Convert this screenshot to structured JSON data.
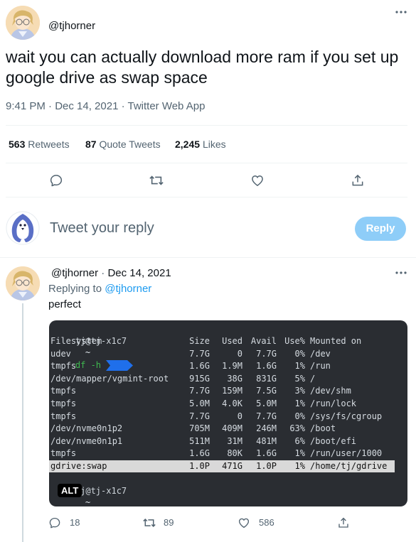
{
  "tweet": {
    "handle": "@tjhorner",
    "text": "wait you can actually download more ram if you set up google drive as swap space",
    "meta": "9:41 PM · Dec 14, 2021 · Twitter Web App",
    "stats": {
      "retweets_count": "563",
      "retweets_label": "Retweets",
      "quotes_count": "87",
      "quotes_label": "Quote Tweets",
      "likes_count": "2,245",
      "likes_label": "Likes"
    }
  },
  "composer": {
    "placeholder": "Tweet your reply",
    "reply_label": "Reply"
  },
  "reply": {
    "handle": "@tjhorner",
    "separator": "·",
    "date": "Dec 14, 2021",
    "replying_prefix": "Replying to",
    "replying_to": "@tjhorner",
    "text": "perfect",
    "alt_badge": "ALT",
    "actions": {
      "replies": "18",
      "retweets": "89",
      "likes": "586"
    }
  },
  "terminal": {
    "prompt_user": "tj@tj-x1c7",
    "prompt_dir": "~",
    "command": "df -h",
    "header": [
      "Filesystem",
      "Size",
      "Used",
      "Avail",
      "Use%",
      "Mounted on"
    ],
    "rows": [
      [
        "udev",
        "7.7G",
        "0",
        "7.7G",
        "0%",
        "/dev"
      ],
      [
        "tmpfs",
        "1.6G",
        "1.9M",
        "1.6G",
        "1%",
        "/run"
      ],
      [
        "/dev/mapper/vgmint-root",
        "915G",
        "38G",
        "831G",
        "5%",
        "/"
      ],
      [
        "tmpfs",
        "7.7G",
        "159M",
        "7.5G",
        "3%",
        "/dev/shm"
      ],
      [
        "tmpfs",
        "5.0M",
        "4.0K",
        "5.0M",
        "1%",
        "/run/lock"
      ],
      [
        "tmpfs",
        "7.7G",
        "0",
        "7.7G",
        "0%",
        "/sys/fs/cgroup"
      ],
      [
        "/dev/nvme0n1p2",
        "705M",
        "409M",
        "246M",
        "63%",
        "/boot"
      ],
      [
        "/dev/nvme0n1p1",
        "511M",
        "31M",
        "481M",
        "6%",
        "/boot/efi"
      ],
      [
        "tmpfs",
        "1.6G",
        "80K",
        "1.6G",
        "1%",
        "/run/user/1000"
      ],
      [
        "gdrive:swap",
        "1.0P",
        "471G",
        "1.0P",
        "1%",
        "/home/tj/gdrive"
      ]
    ],
    "highlighted_row": 9
  },
  "colors": {
    "accent": "#1d9bf0",
    "reply_button": "#8ecdf8",
    "terminal_bg": "#2a2d32",
    "prompt_arrow": "#1f6feb"
  }
}
